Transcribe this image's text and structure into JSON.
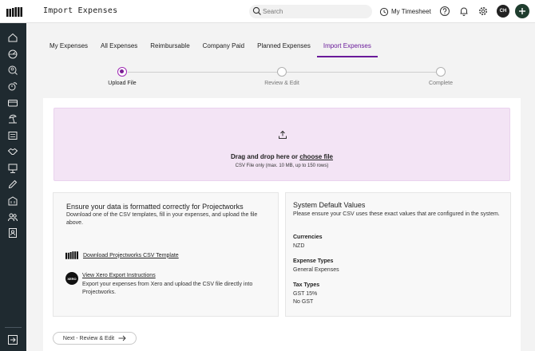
{
  "header": {
    "app_title": "Import Expenses",
    "search_placeholder": "Search",
    "timesheet_label": "My Timesheet",
    "avatar_initials": "CH"
  },
  "sidebar": {
    "icons": [
      "home-icon",
      "dashboard-icon",
      "search-people-icon",
      "timer-icon",
      "card-icon",
      "beach-icon",
      "invoice-icon",
      "handshake-icon",
      "board-icon",
      "edit-icon",
      "building-icon",
      "team-icon",
      "contacts-icon"
    ],
    "collapse_icon": "collapse-icon"
  },
  "tabs": [
    {
      "label": "My Expenses",
      "active": false
    },
    {
      "label": "All Expenses",
      "active": false
    },
    {
      "label": "Reimbursable",
      "active": false
    },
    {
      "label": "Company Paid",
      "active": false
    },
    {
      "label": "Planned Expenses",
      "active": false
    },
    {
      "label": "Import Expenses",
      "active": true
    }
  ],
  "stepper": {
    "steps": [
      {
        "label": "Upload File",
        "active": true
      },
      {
        "label": "Review & Edit",
        "active": false
      },
      {
        "label": "Complete",
        "active": false
      }
    ]
  },
  "dropzone": {
    "text": "Drag and drop here or",
    "link": "choose file",
    "hint": "CSV File only (max. 10 MB, up to 150 rows)"
  },
  "format_panel": {
    "title": "Ensure your data is formatted correctly for Projectworks",
    "description": "Download one of the CSV templates, fill in your expenses, and upload the file above.",
    "template_link": "Download Projectworks CSV Template",
    "xero_badge": "XERO",
    "xero_link": "View Xero Export Instructions",
    "xero_description": "Export your expenses from Xero and upload the CSV file directly into Projectworks."
  },
  "defaults_panel": {
    "title": "System Default Values",
    "description": "Please ensure your CSV uses these exact values that are configured in the system.",
    "groups": [
      {
        "label": "Currencies",
        "values": [
          "NZD"
        ]
      },
      {
        "label": "Expense Types",
        "values": [
          "General Expenses"
        ]
      },
      {
        "label": "Tax Types",
        "values": [
          "GST 15%",
          "No GST"
        ]
      }
    ]
  },
  "footer": {
    "next_label": "Next - Review & Edit"
  },
  "colors": {
    "accent": "#6a1b9a",
    "dropzone_bg": "#f3e4f5",
    "sidebar_bg": "#1f2a30",
    "plus_button": "#1f3d2e"
  }
}
